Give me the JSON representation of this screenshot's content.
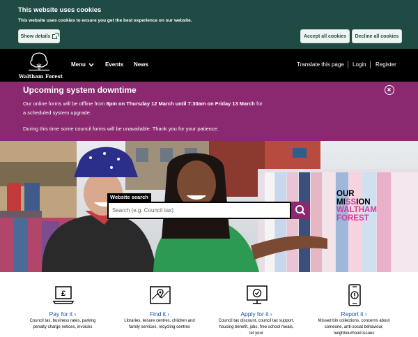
{
  "cookie_banner": {
    "title": "This website uses cookies",
    "text": "This website uses cookies to ensure you get the best experience on our website.",
    "show_details": "Show details",
    "accept": "Accept all cookies",
    "decline": "Decline all cookies"
  },
  "header": {
    "logo_text": "Waltham Forest",
    "nav": {
      "menu": "Menu",
      "events": "Events",
      "news": "News"
    },
    "utility": {
      "translate": "Translate this page",
      "login": "Login",
      "register": "Register"
    }
  },
  "alert": {
    "title": "Upcoming system downtime",
    "p1_pre": "Our online forms will be offline from ",
    "p1_bold": "8pm on Thursday 12 March until 7:30am on Friday 13 March",
    "p1_post": " for a scheduled system upgrade.",
    "p2": "During this time some council forms will be unavailable. Thank you for your patience."
  },
  "search": {
    "label": "Website search",
    "placeholder": "Search (e.g. Council tax)"
  },
  "mission": {
    "line1": "OUR",
    "line2_a": "MI",
    "line2_b": "SS",
    "line2_c": "ION",
    "line3": "WALTHAM",
    "line4": "FOREST"
  },
  "services": [
    {
      "label": "Pay for it",
      "icon": "laptop-pound-icon",
      "desc": "Council tax, business rates, parking penalty charge notices, invoices"
    },
    {
      "label": "Find it",
      "icon": "map-pin-icon",
      "desc": "Libraries, leisure centres, children and family services, recycling centres"
    },
    {
      "label": "Apply for it",
      "icon": "monitor-check-icon",
      "desc": "Council tax discount, council tax support, housing benefit, jobs, free school meals, let your"
    },
    {
      "label": "Report it",
      "icon": "phone-alert-icon",
      "desc": "Missed bin collections, concerns about someone, anti-social behaviour, neighbourhood issues"
    }
  ],
  "colors": {
    "cookie_bg": "#1f4b44",
    "header_bg": "#000000",
    "alert_bg": "#8a2870",
    "link": "#1a4fa0",
    "accent": "#d23f9b"
  }
}
